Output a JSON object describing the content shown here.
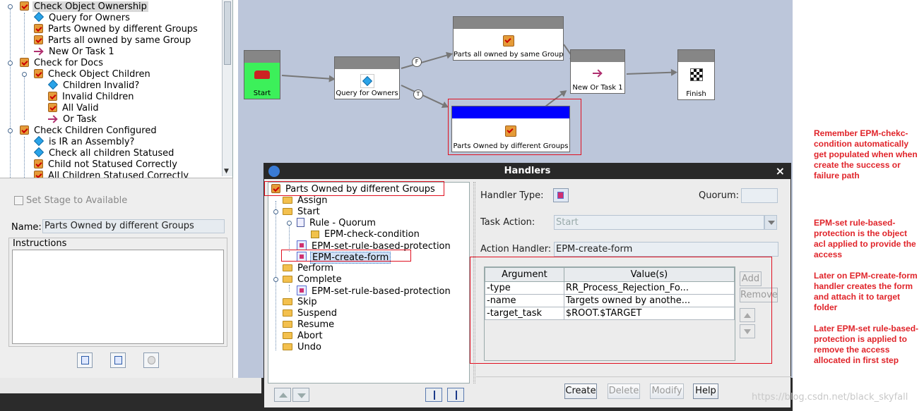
{
  "tree": {
    "items": [
      {
        "label": "Check Object Ownership",
        "icon": "task-icon"
      },
      {
        "label": "Query for Owners",
        "icon": "condition-diamond-icon"
      },
      {
        "label": "Parts Owned by different Groups",
        "icon": "task-icon"
      },
      {
        "label": "Parts all owned by same Group",
        "icon": "task-icon"
      },
      {
        "label": "New Or Task 1",
        "icon": "or-task-icon"
      },
      {
        "label": "Check for Docs",
        "icon": "task-icon"
      },
      {
        "label": "Check Object Children",
        "icon": "task-icon"
      },
      {
        "label": "Children Invalid?",
        "icon": "condition-diamond-icon"
      },
      {
        "label": "Invalid Children",
        "icon": "task-icon"
      },
      {
        "label": "All Valid",
        "icon": "task-icon"
      },
      {
        "label": "Or Task",
        "icon": "or-task-icon"
      },
      {
        "label": "Check Children Configured",
        "icon": "task-icon"
      },
      {
        "label": "is IR an Assembly?",
        "icon": "condition-diamond-icon"
      },
      {
        "label": "Check all children Statused",
        "icon": "condition-diamond-icon"
      },
      {
        "label": "Child not Statused Correctly",
        "icon": "task-icon"
      },
      {
        "label": "All Children Statused Correctly",
        "icon": "task-icon"
      }
    ]
  },
  "props": {
    "stage_label": "Set Stage to Available",
    "name_label": "Name:",
    "name_value": "Parts Owned by different Groups",
    "instructions_label": "Instructions"
  },
  "workflow": {
    "nodes": {
      "start": "Start",
      "query": "Query for Owners",
      "all_same": "Parts all owned by same Group",
      "different": "Parts Owned by different Groups",
      "newor": "New Or Task 1",
      "finish": "Finish"
    },
    "badges": {
      "false": "F",
      "true": "T"
    },
    "colors": {
      "start_fill": "#3cf05a",
      "selected_bar": "#0000ff",
      "highlight": "#e01020"
    }
  },
  "dialog": {
    "title": "Handlers",
    "close": "×",
    "tree": [
      {
        "label": "Parts Owned by different Groups",
        "icon": "task-icon"
      },
      {
        "label": "Assign",
        "icon": "folder-icon"
      },
      {
        "label": "Start",
        "icon": "folder-icon"
      },
      {
        "label": "Rule - Quorum",
        "icon": "rule-icon"
      },
      {
        "label": "EPM-check-condition",
        "icon": "condition-icon"
      },
      {
        "label": "EPM-set-rule-based-protection",
        "icon": "handler-icon"
      },
      {
        "label": "EPM-create-form",
        "icon": "handler-icon"
      },
      {
        "label": "Perform",
        "icon": "folder-icon"
      },
      {
        "label": "Complete",
        "icon": "folder-icon"
      },
      {
        "label": "EPM-set-rule-based-protection",
        "icon": "handler-icon"
      },
      {
        "label": "Skip",
        "icon": "folder-icon"
      },
      {
        "label": "Suspend",
        "icon": "folder-icon"
      },
      {
        "label": "Resume",
        "icon": "folder-icon"
      },
      {
        "label": "Abort",
        "icon": "folder-icon"
      },
      {
        "label": "Undo",
        "icon": "folder-icon"
      }
    ],
    "handler_type_label": "Handler Type:",
    "quorum_label": "Quorum:",
    "task_action_label": "Task Action:",
    "task_action_value": "Start",
    "action_handler_label": "Action Handler:",
    "action_handler_value": "EPM-create-form",
    "table": {
      "headers": [
        "Argument",
        "Value(s)"
      ],
      "rows": [
        [
          "-type",
          "RR_Process_Rejection_Fo..."
        ],
        [
          "-name",
          "Targets owned by anothe..."
        ],
        [
          "-target_task",
          "$ROOT.$TARGET"
        ]
      ]
    },
    "add_label": "Add",
    "remove_label": "Remove",
    "buttons": {
      "create": "Create",
      "delete": "Delete",
      "modify": "Modify",
      "help": "Help"
    }
  },
  "notes": [
    "Remember EPM-chekc-condition automatically get populated when when create the success or failure path",
    "EPM-set rule-based-protection is the object acl applied to provide the access",
    "Later on EPM-create-form handler creates the form and attach it to target folder",
    "Later EPM-set rule-based-protection is applied to remove the access allocated in first step"
  ],
  "watermark": "https://blog.csdn.net/black_skyfall"
}
